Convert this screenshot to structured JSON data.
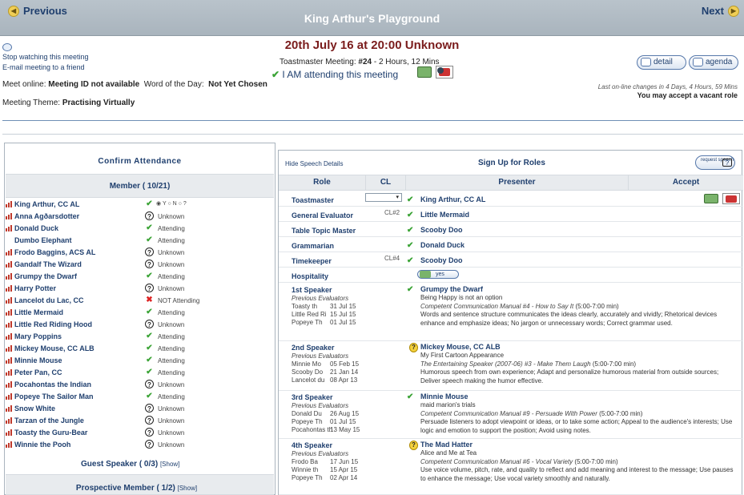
{
  "nav": {
    "prev": "Previous",
    "next": "Next",
    "title": "King Arthur's Playground"
  },
  "meeting": {
    "stop_watching": "Stop watching this meeting",
    "email_friend": "E-mail meeting to a friend",
    "date": "20th July 16 at 20:00 Unknown",
    "tm_prefix": "Toastmaster Meeting:",
    "tm_num": "#24",
    "tm_suffix": "- 2 Hours, 12 Mins",
    "attending": "I AM attending this meeting",
    "online_label": "Meet online:",
    "online_value": "Meeting ID not available",
    "wotd_label": "Word of the Day:",
    "wotd_value": "Not Yet Chosen",
    "theme_label": "Meeting Theme:",
    "theme_value": "Practising Virtually",
    "last_changes": "Last on-line changes in 4 Days, 4 Hours, 59 Mins",
    "vacant": "You may accept a vacant role",
    "detail": "detail",
    "agenda": "agenda"
  },
  "left": {
    "header": "Confirm Attendance",
    "members_title": "Member ( 10/21)",
    "ynq": [
      "Y",
      "N",
      "?"
    ],
    "members": [
      {
        "name": "King Arthur, CC AL",
        "status": "",
        "icon": "radio"
      },
      {
        "name": "Anna Agðarsdotter",
        "status": "Unknown",
        "icon": "q"
      },
      {
        "name": "Donald Duck",
        "status": "Attending",
        "icon": "check"
      },
      {
        "name": "Dumbo Elephant",
        "status": "Attending",
        "icon": "check"
      },
      {
        "name": "Frodo Baggins, ACS AL",
        "status": "Unknown",
        "icon": "q"
      },
      {
        "name": "Gandalf The Wizard",
        "status": "Unknown",
        "icon": "q"
      },
      {
        "name": "Grumpy the Dwarf",
        "status": "Attending",
        "icon": "check"
      },
      {
        "name": "Harry Potter",
        "status": "Unknown",
        "icon": "q"
      },
      {
        "name": "Lancelot du Lac, CC",
        "status": "NOT Attending",
        "icon": "x"
      },
      {
        "name": "Little Mermaid",
        "status": "Attending",
        "icon": "check"
      },
      {
        "name": "Little Red Riding Hood",
        "status": "Unknown",
        "icon": "q"
      },
      {
        "name": "Mary Poppins",
        "status": "Attending",
        "icon": "check"
      },
      {
        "name": "Mickey Mouse, CC ALB",
        "status": "Attending",
        "icon": "check"
      },
      {
        "name": "Minnie Mouse",
        "status": "Attending",
        "icon": "check"
      },
      {
        "name": "Peter Pan, CC",
        "status": "Attending",
        "icon": "check"
      },
      {
        "name": "Pocahontas the Indian",
        "status": "Unknown",
        "icon": "q"
      },
      {
        "name": "Popeye The Sailor Man",
        "status": "Attending",
        "icon": "check"
      },
      {
        "name": "Snow White",
        "status": "Unknown",
        "icon": "q"
      },
      {
        "name": "Tarzan of the Jungle",
        "status": "Unknown",
        "icon": "q"
      },
      {
        "name": "Toasty the Guru-Bear",
        "status": "Unknown",
        "icon": "q"
      },
      {
        "name": "Winnie the Pooh",
        "status": "Unknown",
        "icon": "q"
      }
    ],
    "guest": "Guest Speaker ( 0/3)",
    "prospective": "Prospective Member ( 1/2)",
    "show": "[Show]"
  },
  "right": {
    "hide": "Hide Speech Details",
    "title": "Sign Up for Roles",
    "request": "request speech",
    "cols": {
      "role": "Role",
      "cl": "CL",
      "presenter": "Presenter",
      "accept": "Accept"
    },
    "roles": [
      {
        "role": "Toastmaster",
        "cl": "",
        "presenter": "King Arthur, CC AL"
      },
      {
        "role": "General Evaluator",
        "cl": "CL#2",
        "presenter": "Little Mermaid"
      },
      {
        "role": "Table Topic Master",
        "cl": "",
        "presenter": "Scooby Doo"
      },
      {
        "role": "Grammarian",
        "cl": "",
        "presenter": "Donald Duck"
      },
      {
        "role": "Timekeeper",
        "cl": "CL#4",
        "presenter": "Scooby Doo"
      },
      {
        "role": "Hospitality",
        "cl": "",
        "presenter": ""
      }
    ],
    "yes": "yes",
    "prev_eval": "Previous Evaluators",
    "speakers": [
      {
        "title": "1st Speaker",
        "name": "Grumpy the Dwarf",
        "icon": "check",
        "speech": "Being Happy is not an option",
        "manual": "Competent Communication Manual #4 - How to Say It",
        "time": "(5:00-7:00 min)",
        "desc": "Words and sentence structure communicates the ideas clearly, accurately and vividly; Rhetorical devices enhance and emphasize ideas; No jargon or unnecessary words; Correct grammar used.",
        "evals": [
          [
            "Toasty th",
            "31 Jul 15"
          ],
          [
            "Little Red Ri",
            "15 Jul 15"
          ],
          [
            "Popeye Th",
            "01 Jul 15"
          ]
        ]
      },
      {
        "title": "2nd Speaker",
        "name": "Mickey Mouse, CC ALB",
        "icon": "qy",
        "speech": "My First Cartoon Appearance",
        "manual": "The Entertaining Speaker (2007-06) #3 - Make Them Laugh",
        "time": "(5:00-7:00 min)",
        "desc": "Humorous speech from own experience; Adapt and personalize humorous material from outside sources; Deliver speech making the humor effective.",
        "evals": [
          [
            "Minnie Mo",
            "05 Feb 15"
          ],
          [
            "Scooby Do",
            "21 Jan 14"
          ],
          [
            "Lancelot du",
            "08 Apr 13"
          ]
        ]
      },
      {
        "title": "3rd Speaker",
        "name": "Minnie Mouse",
        "icon": "check",
        "speech": "maid marion's trials",
        "manual": "Competent Communication Manual #9 - Persuade With Power",
        "time": "(5:00-7:00 min)",
        "desc": "Persuade listeners to adopt viewpoint or ideas, or to take some action; Appeal to the audience's interests; Use logic and emotion to support the position; Avoid using notes.",
        "evals": [
          [
            "Donald Du",
            "26 Aug 15"
          ],
          [
            "Popeye Th",
            "01 Jul 15"
          ],
          [
            "Pocahontas th",
            "13 May 15"
          ]
        ]
      },
      {
        "title": "4th Speaker",
        "name": "The Mad Hatter",
        "icon": "qy",
        "speech": "Alice and Me at Tea",
        "manual": "Competent Communication Manual #6 - Vocal Variety",
        "time": "(5:00-7:00 min)",
        "desc": "Use voice volume, pitch, rate, and quality to reflect and add meaning and interest to the message; Use pauses to enhance the message; Use vocal variety smoothly and naturally.",
        "evals": [
          [
            "Frodo Ba",
            "17 Jun 15"
          ],
          [
            "Winnie th",
            "15 Apr 15"
          ],
          [
            "Popeye Th",
            "02 Apr 14"
          ]
        ]
      }
    ]
  }
}
